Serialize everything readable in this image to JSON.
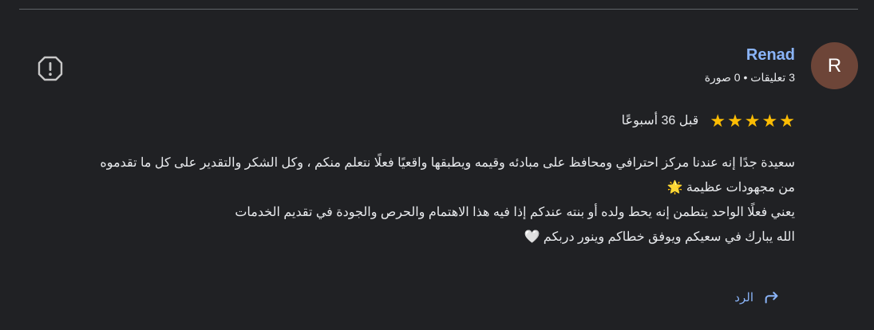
{
  "review": {
    "author": "Renad",
    "avatar_letter": "R",
    "meta": "3 تعليقات • 0 صورة",
    "stars": [
      "★",
      "★",
      "★",
      "★",
      "★"
    ],
    "rating": 5,
    "time": "قبل 36 أسبوعًا",
    "lines": [
      "سعيدة جدًا إنه عندنا مركز احترافي ومحافظ على مبادئه وقيمه ويطبقها واقعيًا فعلًا نتعلم منكم ، وكل الشكر والتقدير على كل ما تقدموه",
      "من مجهودات عظيمة 🌟",
      "يعني فعلًا الواحد يتطمن إنه يحط ولده أو بنته عندكم إذا فيه هذا الاهتمام والحرص والجودة في تقديم الخدمات",
      "الله يبارك في سعيكم ويوفق خطاكم وينور دربكم 🤍"
    ],
    "reply_label": "الرد"
  },
  "colors": {
    "background": "#202124",
    "link": "#8ab4f8",
    "star": "#fbbc04",
    "avatar": "#6d4538"
  },
  "icons": {
    "report": "report-icon",
    "reply": "reply-arrow-icon",
    "star": "star-icon"
  }
}
